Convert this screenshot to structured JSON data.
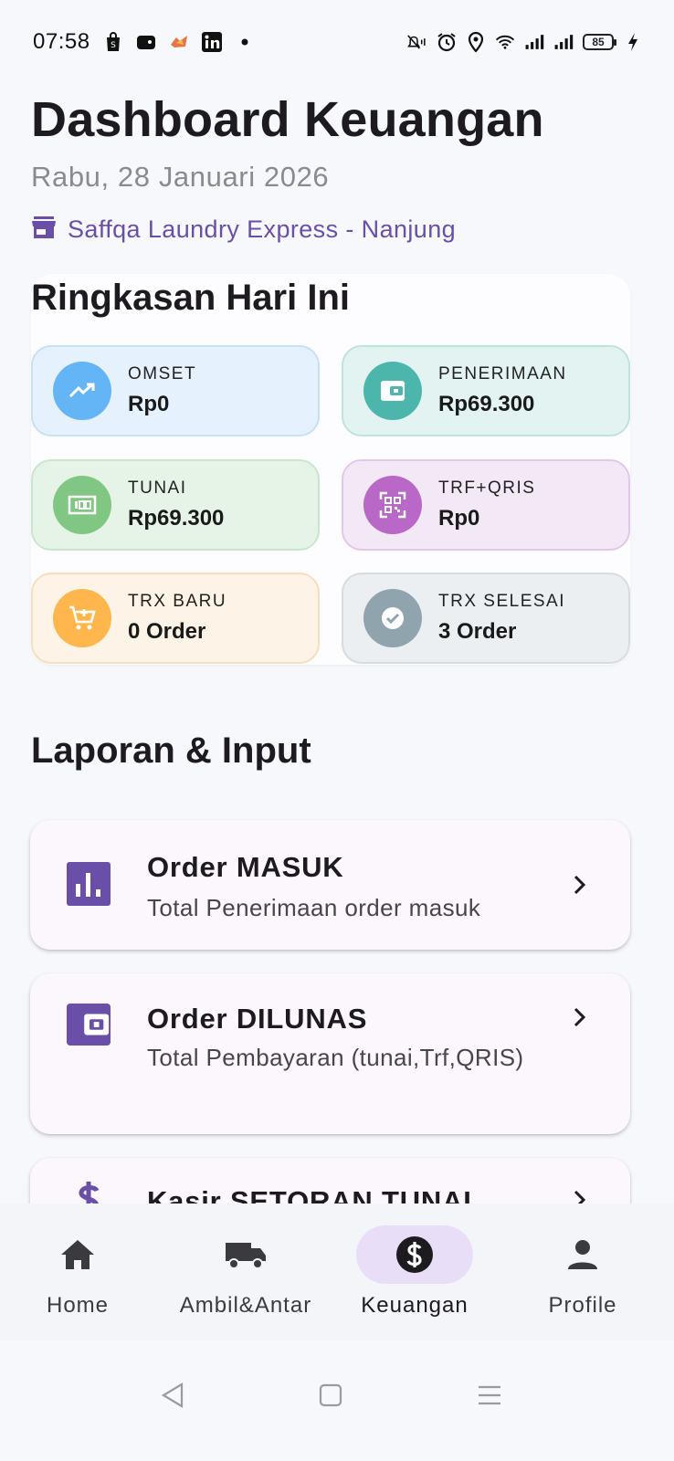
{
  "status_bar": {
    "time": "07:58",
    "battery": "85",
    "icons": [
      "shopee-bag-icon",
      "wallet-app-icon",
      "game-icon",
      "linkedin-icon",
      "dot-icon",
      "mute-icon",
      "alarm-icon",
      "location-icon",
      "wifi-icon",
      "signal-icon",
      "signal-icon",
      "battery-icon",
      "charging-icon"
    ]
  },
  "header": {
    "title": "Dashboard Keuangan",
    "date": "Rabu, 28 Januari 2026",
    "store": "Saffqa Laundry Express - Nanjung"
  },
  "summary": {
    "title": "Ringkasan Hari Ini",
    "cards": [
      {
        "label": "OMSET",
        "value": "Rp0",
        "icon": "trending-up-icon",
        "color": "#64b5f6"
      },
      {
        "label": "PENERIMAAN",
        "value": "Rp69.300",
        "icon": "wallet-icon",
        "color": "#4db6ac"
      },
      {
        "label": "TUNAI",
        "value": "Rp69.300",
        "icon": "cash-icon",
        "color": "#81c784"
      },
      {
        "label": "TRF+QRIS",
        "value": "Rp0",
        "icon": "qr-code-icon",
        "color": "#ba68c8"
      },
      {
        "label": "TRX BARU",
        "value": "0 Order",
        "icon": "cart-add-icon",
        "color": "#ffb74d"
      },
      {
        "label": "TRX SELESAI",
        "value": "3 Order",
        "icon": "check-circle-icon",
        "color": "#90a4ae"
      }
    ]
  },
  "reports": {
    "title": "Laporan & Input",
    "items": [
      {
        "title": "Order MASUK",
        "subtitle": "Total Penerimaan order masuk",
        "icon": "bar-chart-icon"
      },
      {
        "title": "Order DILUNAS",
        "subtitle": "Total Pembayaran (tunai,Trf,QRIS)",
        "icon": "wallet-icon"
      },
      {
        "title": "Kasir SETORAN TUNAI",
        "subtitle": "",
        "icon": "dollar-icon"
      }
    ]
  },
  "bottom_nav": {
    "items": [
      {
        "label": "Home",
        "icon": "home-icon",
        "active": false
      },
      {
        "label": "Ambil&Antar",
        "icon": "truck-icon",
        "active": false
      },
      {
        "label": "Keuangan",
        "icon": "dollar-circle-icon",
        "active": true
      },
      {
        "label": "Profile",
        "icon": "person-icon",
        "active": false
      }
    ]
  },
  "colors": {
    "accent": "#6a4fa8",
    "nav_active_bg": "#e8def8",
    "menu_icon": "#6a4fa8"
  }
}
